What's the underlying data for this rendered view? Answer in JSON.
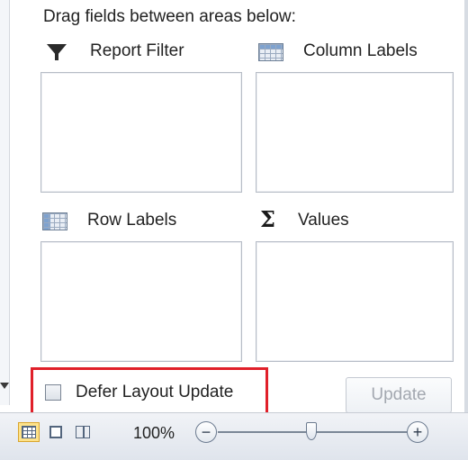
{
  "header": {
    "instruction": "Drag fields between areas below:"
  },
  "areas": {
    "report_filter": {
      "label": "Report Filter",
      "icon": "funnel-icon"
    },
    "column_labels": {
      "label": "Column Labels",
      "icon": "column-grid-icon"
    },
    "row_labels": {
      "label": "Row Labels",
      "icon": "row-grid-icon"
    },
    "values": {
      "label": "Values",
      "icon": "sigma-icon"
    }
  },
  "footer": {
    "defer_label": "Defer Layout Update",
    "defer_checked": false,
    "update_label": "Update",
    "update_enabled": false
  },
  "status_bar": {
    "zoom_level": "100%",
    "zoom_minus": "−",
    "zoom_plus": "+",
    "active_view": "normal"
  },
  "colors": {
    "highlight": "#e0202a",
    "active_view_bg": "#fde28a"
  }
}
